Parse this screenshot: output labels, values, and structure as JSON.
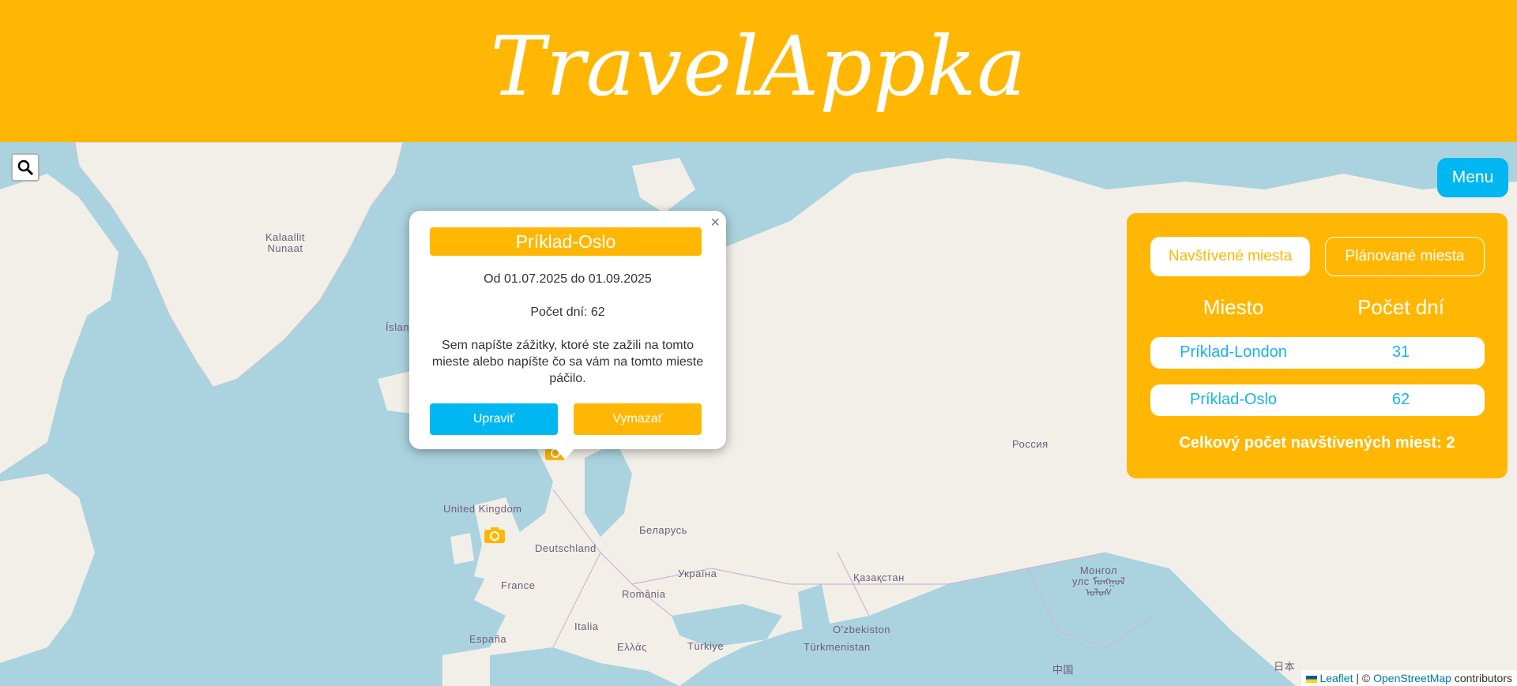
{
  "app": {
    "title": "TravelAppka"
  },
  "map": {
    "places": [
      {
        "name": "kalaallit",
        "text": "Kalaallit\nNunaat"
      },
      {
        "name": "island",
        "text": "Íslan"
      },
      {
        "name": "uk",
        "text": "United Kingdom"
      },
      {
        "name": "deutschland",
        "text": "Deutschland"
      },
      {
        "name": "france",
        "text": "France"
      },
      {
        "name": "espana",
        "text": "España"
      },
      {
        "name": "italia",
        "text": "Italia"
      },
      {
        "name": "ellas",
        "text": "Ελλάς"
      },
      {
        "name": "romania",
        "text": "România"
      },
      {
        "name": "ukraina",
        "text": "Україна"
      },
      {
        "name": "belarus",
        "text": "Беларусь"
      },
      {
        "name": "turkiye",
        "text": "Türkiye"
      },
      {
        "name": "rossiya",
        "text": "Россия"
      },
      {
        "name": "kazakhstan",
        "text": "Қазақстан"
      },
      {
        "name": "ozbekiston",
        "text": "O'zbekiston"
      },
      {
        "name": "turkmenistan",
        "text": "Türkmenistan"
      },
      {
        "name": "mongol",
        "text": "Монгол\nулс ᠮᠣᠩᠭᠣᠯ\nᠤᠯᠤᠰ"
      },
      {
        "name": "china",
        "text": "中国"
      },
      {
        "name": "japan",
        "text": "日本"
      }
    ]
  },
  "search": {
    "icon": "search-icon"
  },
  "menu": {
    "label": "Menu"
  },
  "panel": {
    "tabs": [
      "Navštívené miesta",
      "Plánované miesta"
    ],
    "columns": [
      "Miesto",
      "Počet dní"
    ],
    "rows": [
      {
        "place": "Príklad-London",
        "days": "31"
      },
      {
        "place": "Príklad-Oslo",
        "days": "62"
      }
    ],
    "total": "Celkový počet navštívených miest: 2"
  },
  "popup": {
    "title": "Príklad-Oslo",
    "dates": "Od 01.07.2025 do 01.09.2025",
    "days": "Počet dní: 62",
    "note": "Sem napíšte zážitky, ktoré ste zažili na tomto mieste alebo napíšte čo sa vám na tomto mieste páčilo.",
    "edit_label": "Upraviť",
    "delete_label": "Vymazať",
    "close": "×"
  },
  "attribution": {
    "leaflet": "Leaflet",
    "sep": " | © ",
    "osm": "OpenStreetMap",
    "suffix": " contributors"
  },
  "colors": {
    "accent": "#ffb703",
    "primary": "#00b7f1",
    "water": "#aad3df",
    "land": "#f2efe9"
  }
}
